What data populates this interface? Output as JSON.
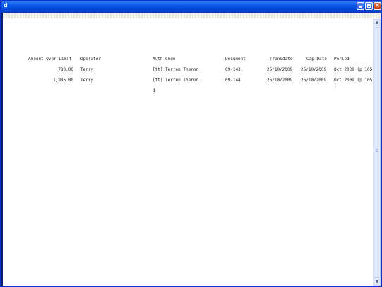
{
  "window": {
    "title": "d",
    "minimize_label": "",
    "close_label": "×"
  },
  "report": {
    "columns": {
      "amount_over_limit": "Amount Over Limit",
      "operator": "Operator",
      "auth_code": "Auth Code",
      "document": "Document",
      "transdate": "Transdate",
      "cap_date": "Cap Date",
      "period": "Period"
    },
    "rows": [
      {
        "amount_over_limit": "780.00",
        "operator": "Terry",
        "auth_code": "[tt] Terren Theron",
        "document": "09-143",
        "transdate": "26/10/2009",
        "cap_date": "26/10/2009",
        "period": "Oct 2009 (p 105",
        "period_cont": "|"
      },
      {
        "amount_over_limit": "1,985.00",
        "operator": "Terry",
        "auth_code": "[tt] Terren Theron",
        "auth_code_cont": "d",
        "document": "09-144",
        "transdate": "26/10/2009",
        "cap_date": "26/10/2009",
        "period": "Oct 2009 (p 105",
        "period_cont": "|"
      }
    ]
  },
  "scrollbar": {
    "up_icon": "arrow-up-icon",
    "down_icon": "arrow-down-icon"
  }
}
